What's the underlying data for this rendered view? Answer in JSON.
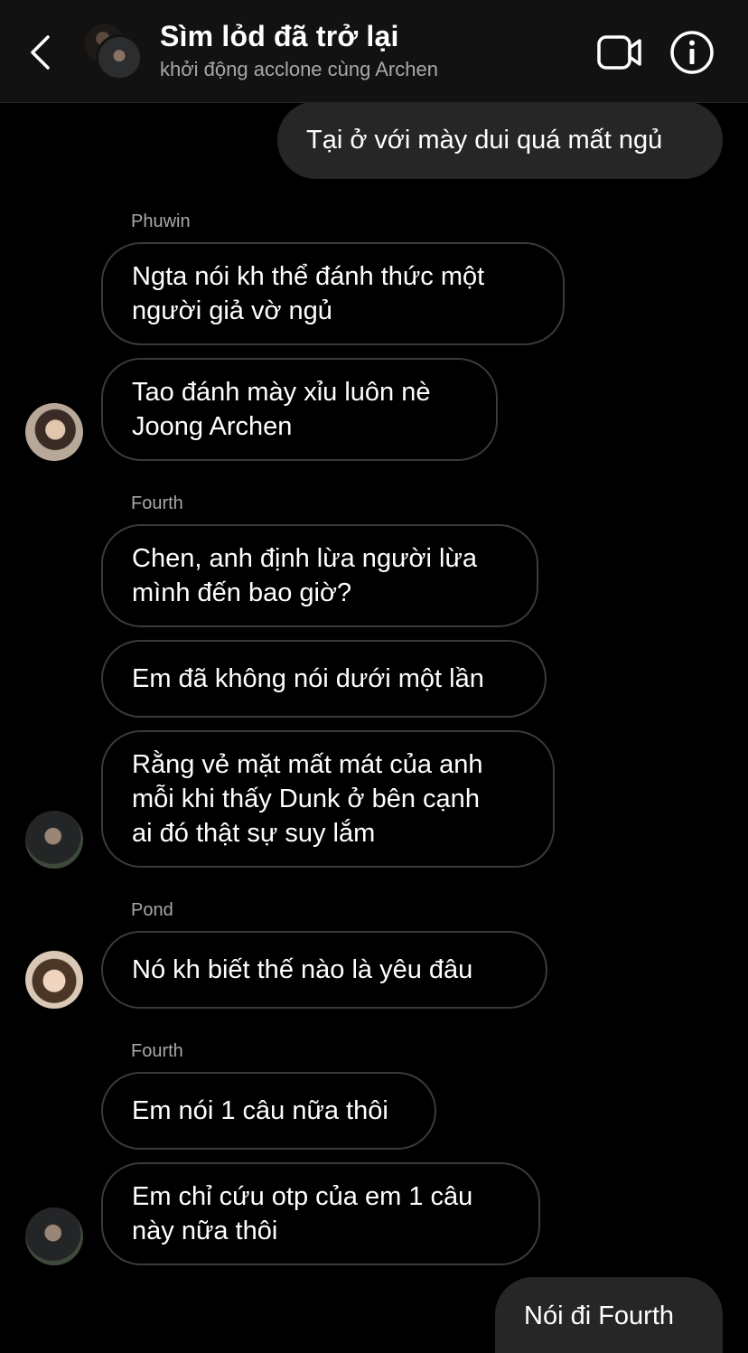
{
  "header": {
    "title": "Sìm lỏd đã trở lại",
    "subtitle": "khởi động acclone cùng Archen"
  },
  "messages": {
    "m1": "Tại ở với mày dui quá mất ngủ",
    "sender_phuwin": "Phuwin",
    "m2": "Ngta nói kh thể đánh thức một\nngười giả vờ ngủ",
    "m3": "Tao đánh mày xỉu luôn nè\nJoong Archen",
    "sender_fourth_1": "Fourth",
    "m4": "Chen, anh định lừa người lừa\nmình đến bao giờ?",
    "m5": "Em đã không nói dưới một lần",
    "m6": "Rằng vẻ mặt mất mát của anh\nmỗi khi thấy Dunk ở bên cạnh\nai đó thật sự suy lắm",
    "sender_pond": "Pond",
    "m7": "Nó kh biết thế nào là yêu đâu",
    "sender_fourth_2": "Fourth",
    "m8": "Em nói 1 câu nữa thôi",
    "m9": "Em chỉ cứu otp của em 1 câu\nnày nữa thôi",
    "m10": "Nói đi Fourth"
  }
}
